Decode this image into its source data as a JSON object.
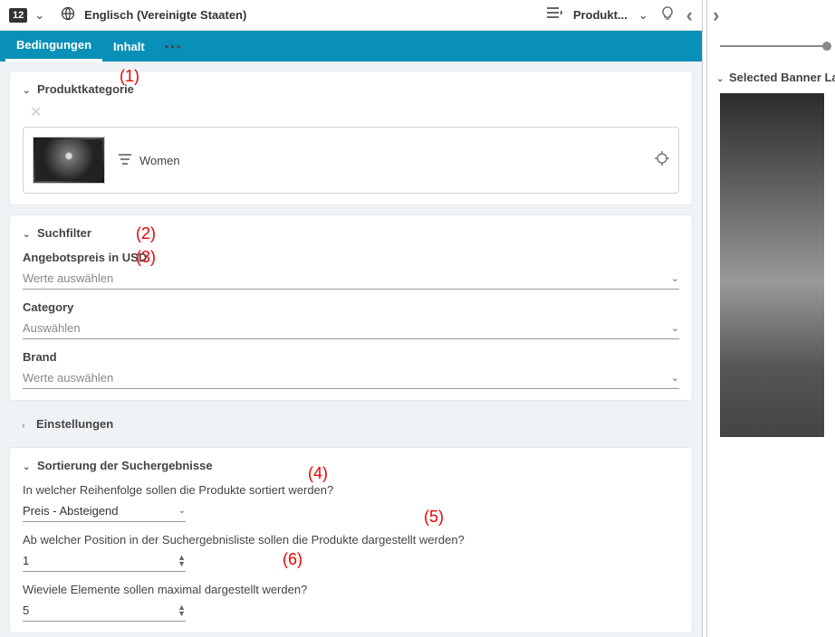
{
  "topbar": {
    "badge": "12",
    "language": "Englisch (Vereinigte Staaten)",
    "produkt_label": "Produkt..."
  },
  "tabs": {
    "bedingungen": "Bedingungen",
    "inhalt": "Inhalt"
  },
  "produktkategorie": {
    "title": "Produktkategorie",
    "category_name": "Women"
  },
  "suchfilter": {
    "title": "Suchfilter",
    "angebotspreis_label": "Angebotspreis in USD",
    "angebotspreis_placeholder": "Werte auswählen",
    "category_label": "Category",
    "category_placeholder": "Auswählen",
    "brand_label": "Brand",
    "brand_placeholder": "Werte auswählen"
  },
  "einstellungen": {
    "title": "Einstellungen"
  },
  "sortierung": {
    "title": "Sortierung der Suchergebnisse",
    "order_label": "In welcher Reihenfolge sollen die Produkte sortiert werden?",
    "order_value": "Preis - Absteigend",
    "position_label": "Ab welcher Position in der Suchergebnisliste sollen die Produkte dargestellt werden?",
    "position_value": "1",
    "max_label": "Wieviele Elemente sollen maximal dargestellt werden?",
    "max_value": "5"
  },
  "right": {
    "selected_banner": "Selected Banner Layou"
  },
  "annotations": {
    "a1": "(1)",
    "a2": "(2)",
    "a3": "(3)",
    "a4": "(4)",
    "a5": "(5)",
    "a6": "(6)"
  }
}
